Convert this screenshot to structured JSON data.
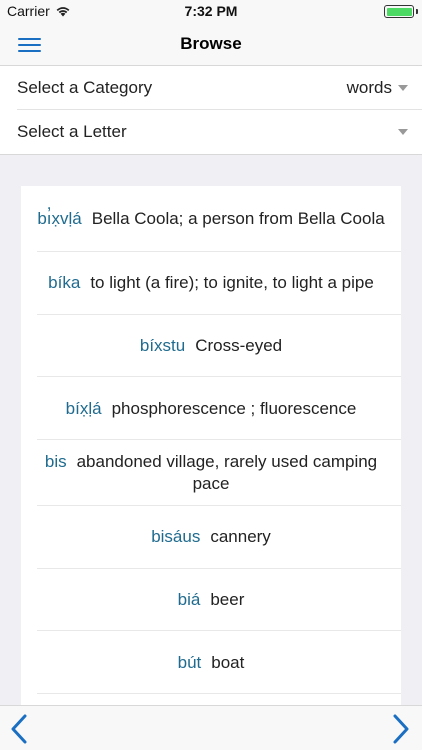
{
  "status": {
    "carrier": "Carrier",
    "time": "7:32 PM",
    "battery_color": "#4cd964"
  },
  "nav": {
    "title": "Browse",
    "menu_icon": "hamburger-menu-icon"
  },
  "selectors": [
    {
      "label": "Select a Category",
      "value": "words"
    },
    {
      "label": "Select a Letter",
      "value": ""
    }
  ],
  "entries": [
    {
      "term": "bı̓x̣vḷá",
      "definition": "Bella Coola; a person from Bella Coola"
    },
    {
      "term": "bíka",
      "definition": "to light (a fire); to ignite, to light a pipe"
    },
    {
      "term": "bíxstu",
      "definition": "Cross-eyed"
    },
    {
      "term": "bíx̣ḷá",
      "definition": "phosphorescence ; fluorescence"
    },
    {
      "term": "bis",
      "definition": "abandoned village, rarely used camping pace"
    },
    {
      "term": "bisáus",
      "definition": "cannery"
    },
    {
      "term": "biá",
      "definition": "beer"
    },
    {
      "term": "bút",
      "definition": "boat"
    },
    {
      "term": "",
      "definition": ""
    }
  ],
  "toolbar": {
    "prev_icon": "chevron-left-icon",
    "next_icon": "chevron-right-icon",
    "accent_color": "#1a6fc2"
  },
  "colors": {
    "term": "#1f6b8f",
    "background": "#efeff4"
  }
}
